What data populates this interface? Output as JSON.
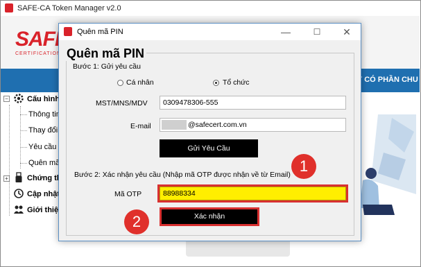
{
  "main_window": {
    "title": "SAFE-CA Token Manager v2.0",
    "logo": "SAFE",
    "logo_sub": "CERTIFICATION",
    "company_banner": "Y CÓ PHẦN CHU"
  },
  "sidebar": {
    "items": [
      {
        "label": "Cấu hình",
        "bold": true,
        "icon": "gear-icon"
      },
      {
        "label": "Thông tin P",
        "bold": false
      },
      {
        "label": "Thay đổi m",
        "bold": false
      },
      {
        "label": "Yêu cầu mo",
        "bold": false
      },
      {
        "label": "Quên mã P",
        "bold": false
      },
      {
        "label": "Chứng th",
        "bold": true,
        "icon": "usb-token-icon"
      },
      {
        "label": "Cập nhật",
        "bold": true,
        "icon": "update-icon"
      },
      {
        "label": "Giới thiệu",
        "bold": true,
        "icon": "people-icon"
      }
    ]
  },
  "dialog": {
    "title": "Quên mã PIN",
    "heading": "Quên mã PIN",
    "step1_label": "Bước 1: Gửi yêu cầu",
    "radio_personal": "Cá nhân",
    "radio_org": "Tổ chức",
    "radio_selected": "org",
    "mst_label": "MST/MNS/MDV",
    "mst_value": "0309478306-555",
    "email_label": "E-mail",
    "email_value": "@safecert.com.vn",
    "send_button": "Gửi Yêu Cầu",
    "step2_label": "Bước 2: Xác nhận yêu cầu (Nhập mã OTP được nhận về từ Email)",
    "otp_label": "Mã OTP",
    "otp_value": "88988334",
    "confirm_button": "Xác nhận",
    "minimize": "—",
    "maximize": "☐",
    "close": "✕"
  },
  "annotations": {
    "badge1": "1",
    "badge2": "2",
    "accent": "#e0302b"
  }
}
